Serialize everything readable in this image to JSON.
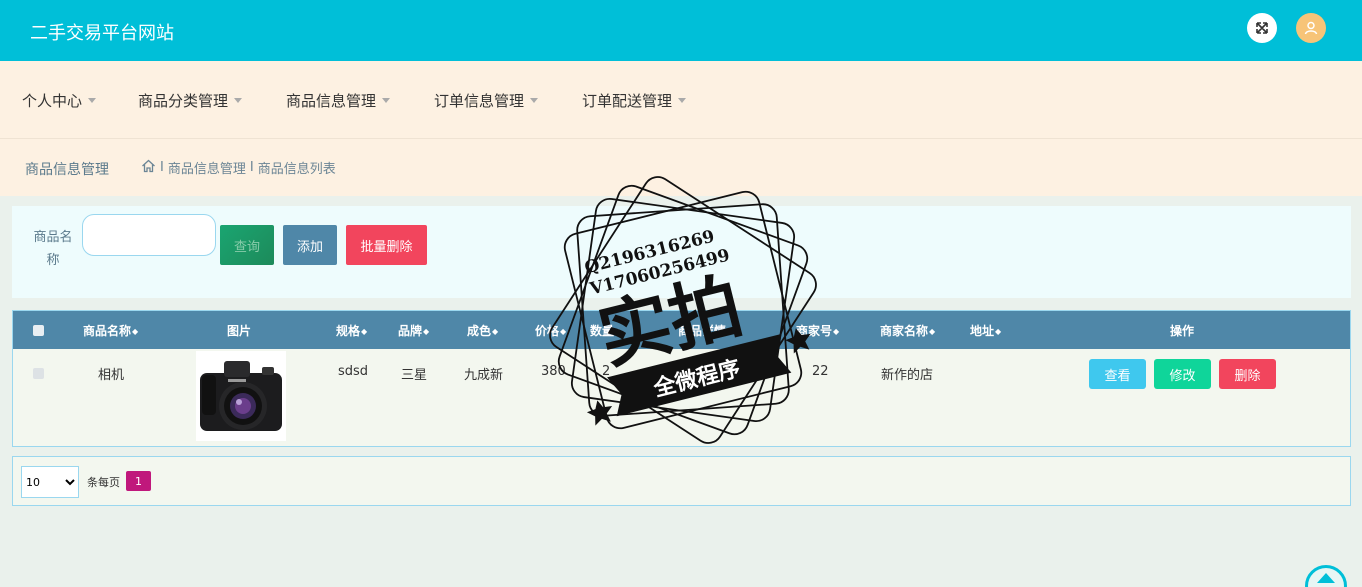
{
  "header": {
    "title": "二手交易平台网站",
    "icons": [
      "fullscreen-icon",
      "user-icon"
    ]
  },
  "nav": {
    "items": [
      "个人中心",
      "商品分类管理",
      "商品信息管理",
      "订单信息管理",
      "订单配送管理"
    ]
  },
  "breadcrumb": {
    "title": "商品信息管理",
    "path": [
      "商品信息管理",
      "商品信息列表"
    ],
    "separator": "I"
  },
  "search": {
    "label": "商品名称",
    "input_value": "",
    "query_label": "查询",
    "add_label": "添加",
    "batch_delete_label": "批量删除"
  },
  "table": {
    "columns": [
      "商品名称",
      "图片",
      "规格",
      "品牌",
      "成色",
      "价格",
      "数量",
      "商品详情",
      "商家号",
      "商家名称",
      "地址",
      "操作"
    ],
    "sortable": "◆",
    "rows": [
      {
        "name": "相机",
        "image": "camera-photo",
        "spec": "sdsd",
        "brand": "三星",
        "condition": "九成新",
        "price": "380",
        "qty": "2",
        "detail": "",
        "merchant_no": "22",
        "merchant_name": "新作的店",
        "address": ""
      }
    ],
    "actions": {
      "view": "查看",
      "edit": "修改",
      "delete": "删除"
    }
  },
  "pager": {
    "page_size": "10",
    "per_page_label": "条每页",
    "current_page": "1"
  },
  "watermark": {
    "contact1": "Q2196316269",
    "contact2": "V17060256499",
    "main": "实拍",
    "sub": "全微程序"
  },
  "colors": {
    "header": "#00bfd8",
    "nav_bg": "#fdf1e2",
    "table_head": "#4f87a8",
    "view": "#3fc8ee",
    "edit": "#0fd59a",
    "delete": "#f2455d",
    "page": "#c0187c"
  }
}
